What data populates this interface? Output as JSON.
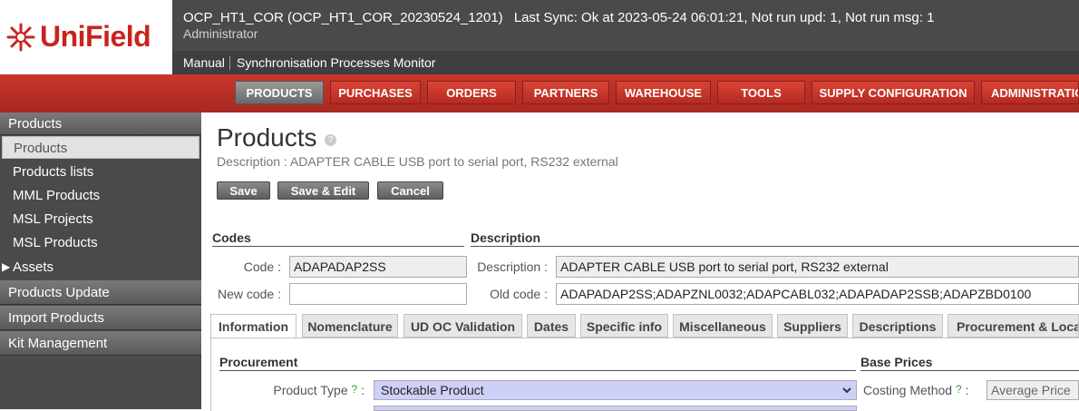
{
  "brand": {
    "logo_text": "UniField"
  },
  "topbar": {
    "instance": "OCP_HT1_COR (OCP_HT1_COR_20230524_1201)",
    "sync": "Last Sync: Ok at 2023-05-24 06:01:21, Not run upd: 1, Not run msg: 1",
    "user": "Administrator",
    "links": [
      "Manual",
      "Synchronisation Processes Monitor"
    ]
  },
  "menu": {
    "items": [
      "PRODUCTS",
      "PURCHASES",
      "ORDERS",
      "PARTNERS",
      "WAREHOUSE",
      "TOOLS",
      "SUPPLY CONFIGURATION",
      "ADMINISTRATION"
    ],
    "active": "PRODUCTS"
  },
  "sidebar": {
    "section": "Products",
    "items": [
      "Products",
      "Products lists",
      "MML Products",
      "MSL Projects",
      "MSL Products",
      "Assets"
    ],
    "groups": [
      "Products Update",
      "Import Products",
      "Kit Management"
    ]
  },
  "page": {
    "title": "Products",
    "help": "?",
    "description": "Description : ADAPTER CABLE USB port to serial port, RS232 external",
    "buttons": {
      "save": "Save",
      "save_edit": "Save & Edit",
      "cancel": "Cancel"
    }
  },
  "codes": {
    "heading": "Codes",
    "code_label": "Code :",
    "code_value": "ADAPADAP2SS",
    "new_code_label": "New code :",
    "new_code_value": ""
  },
  "description": {
    "heading": "Description",
    "desc_label": "Description :",
    "desc_value": "ADAPTER CABLE USB port to serial port, RS232 external",
    "old_code_label": "Old code :",
    "old_code_value": "ADAPADAP2SS;ADAPZNL0032;ADAPCABL032;ADAPADAP2SSB;ADAPZBD0100"
  },
  "tabs": [
    "Information",
    "Nomenclature",
    "UD OC Validation",
    "Dates",
    "Specific info",
    "Miscellaneous",
    "Suppliers",
    "Descriptions",
    "Procurement & Locations"
  ],
  "procurement": {
    "heading": "Procurement",
    "product_type_label": "Product Type",
    "product_type_value": "Stockable Product",
    "q": "?"
  },
  "base_prices": {
    "heading": "Base Prices",
    "costing_label": "Costing Method",
    "costing_value": "Average Price"
  },
  "colors": {
    "accent": "#c8372c",
    "sidebar": "#4a4a4a"
  }
}
